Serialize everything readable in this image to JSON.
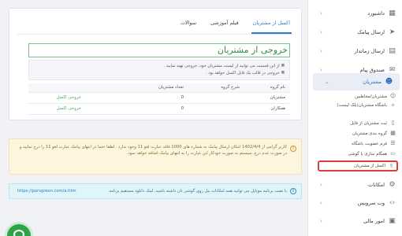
{
  "tabs": [
    {
      "label": "اکسل از مشتریان",
      "active": true
    },
    {
      "label": "فیلم آموزشی",
      "active": false
    },
    {
      "label": "سوالات",
      "active": false
    }
  ],
  "page_title": "خروجی از مشتریان",
  "info_lines": [
    "از این قسمت می توانید از لیست مشتریان خود، خروجی تهیه نمایید .",
    "خروجی در قالب یک فایل اکسل خواهد بود ."
  ],
  "table": {
    "headers": {
      "name": "نام گروه",
      "desc": "شرح گروه",
      "count": "تعداد مشتریان",
      "action": ""
    },
    "rows": [
      {
        "name": "مشتریان",
        "desc": "",
        "count": "0",
        "action": "خروجی اکسل"
      },
      {
        "name": "همکاران",
        "desc": "",
        "count": "0",
        "action": "خروجی اکسل"
      }
    ]
  },
  "alerts": {
    "warning": "کاربر گرامی از 1402/4/4 امکان ارسال پیامک به شماره های 1000 فاقد عبارت لغو 11 وجود ندارد . لطفا حتما در انتهای پیامک عبارت لغو 11 را درج نمایید و در صورت عدم درج، سیستم به صورت خودکار این عبارت را به انتهای پیامک اضافه خواهد نمود.",
    "info": "با نصب برنامه موبایل می توانید همه امکانات پنل روی گوشی تان داشته باشید. لینک دانلود مستقیم برنامه",
    "info_url": "https://parsgreen.com/a.htm"
  },
  "sidebar": {
    "items": [
      {
        "label": "داشبورد",
        "icon": "dashboard-icon"
      },
      {
        "label": "ارسال پیامک",
        "icon": "send-icon"
      },
      {
        "label": "ارسال زماندار",
        "icon": "calendar-icon"
      },
      {
        "label": "صندوق پیام",
        "icon": "inbox-icon"
      },
      {
        "label": "مشتریان",
        "icon": "users-icon"
      },
      {
        "label": "امکانات",
        "icon": "gear-icon"
      },
      {
        "label": "وب سرویس",
        "icon": "code-icon"
      },
      {
        "label": "امور مالی",
        "icon": "wallet-icon"
      }
    ],
    "customer_sub": [
      {
        "label": "مشتریان/مخاطبین",
        "icon": "contact-icon"
      },
      {
        "label": "باشگاه مشتریان(بلک لیست)",
        "icon": "club-icon"
      },
      {
        "label": "ثبت مشتریان از فایل",
        "icon": "file-icon"
      },
      {
        "label": "گروه بندی مشتریان",
        "icon": "group-icon"
      },
      {
        "label": "فرم عضویت باشگاه",
        "icon": "form-icon"
      },
      {
        "label": "همگام سازی با گوشی",
        "icon": "sync-icon"
      },
      {
        "label": "اکسل از مشتریان",
        "icon": "export-icon"
      }
    ]
  },
  "colors": {
    "accent": "#2f67c1",
    "success": "#3fae5a",
    "highlight_border": "#e03a3a"
  }
}
